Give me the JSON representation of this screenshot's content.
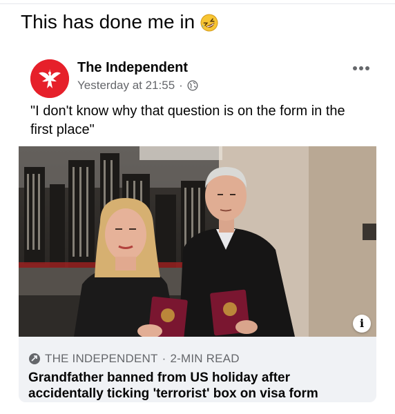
{
  "caption": {
    "text": "This has done me in",
    "emoji": "rolling-on-floor-laughing-emoji"
  },
  "post": {
    "page_name": "The Independent",
    "timestamp": "Yesterday at 21:55",
    "separator": "·",
    "audience_icon": "globe-icon",
    "more_icon": "more-options-icon",
    "text": "\"I don't know why that question is on the form in the first place\""
  },
  "link_preview": {
    "source_icon": "share-link-icon",
    "source": "THE INDEPENDENT",
    "separator": "·",
    "read_time": "2-MIN READ",
    "headline": "Grandfather banned from US holiday after accidentally ticking 'terrorist' box on visa form",
    "info_label": "i"
  },
  "colors": {
    "brand_red": "#e6202a",
    "secondary_text": "#65676b",
    "preview_bg": "#f0f2f5"
  }
}
